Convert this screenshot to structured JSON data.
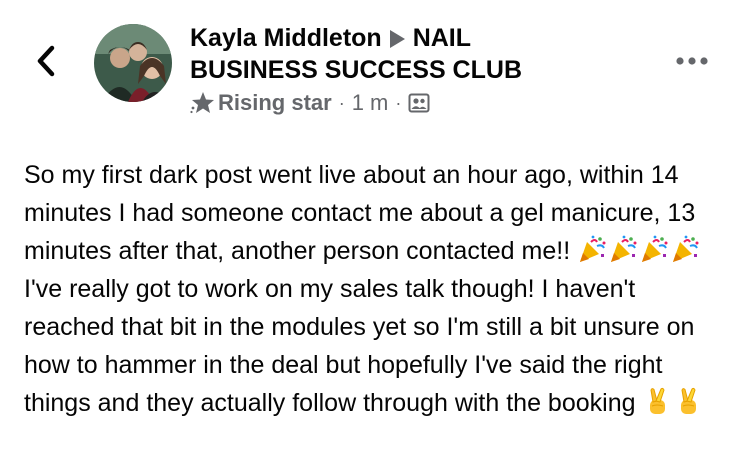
{
  "header": {
    "author_name": "Kayla Middleton",
    "group_name_line1": "NAIL",
    "group_name_line2": "BUSINESS SUCCESS CLUB",
    "badge": "Rising star",
    "separator": "·",
    "timestamp": "1 m",
    "back_icon": "chevron-left-icon",
    "more_icon": "more-horizontal-icon",
    "audience_icon": "group-members-icon",
    "badge_icon": "star-icon"
  },
  "post": {
    "text_part1": "So my first dark post went live about an hour ago, within 14 minutes I had someone contact me about a gel manicure, 13 minutes after that, another person contacted me!! ",
    "text_part2": " I've really got to work on my sales talk though! I haven't reached that bit in the modules yet so I'm still a bit unsure on how to hammer in the deal but hopefully I've said the right things and they actually follow through with the booking ",
    "party_emoji_count": 4,
    "crossed_fingers_count": 2
  },
  "colors": {
    "text": "#050505",
    "secondary": "#65676b",
    "background": "#ffffff"
  }
}
